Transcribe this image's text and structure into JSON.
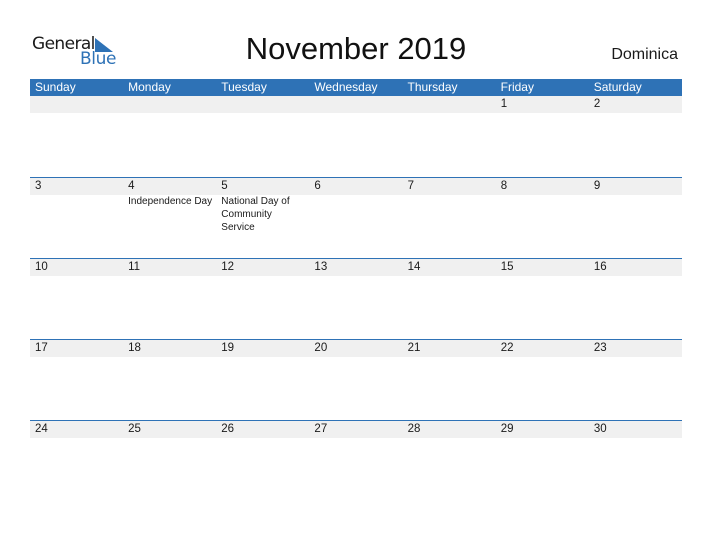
{
  "logo": {
    "general": "General",
    "blue": "Blue",
    "icon": "triangle-flag-icon",
    "brand_color": "#2e72b6"
  },
  "title": "November 2019",
  "country": "Dominica",
  "colors": {
    "header_bg": "#2e72b6",
    "date_strip_bg": "#f0f0f0",
    "week_divider": "#2e72b6"
  },
  "weekdays": [
    "Sunday",
    "Monday",
    "Tuesday",
    "Wednesday",
    "Thursday",
    "Friday",
    "Saturday"
  ],
  "weeks": [
    [
      {
        "day": ""
      },
      {
        "day": ""
      },
      {
        "day": ""
      },
      {
        "day": ""
      },
      {
        "day": ""
      },
      {
        "day": "1"
      },
      {
        "day": "2"
      }
    ],
    [
      {
        "day": "3"
      },
      {
        "day": "4",
        "holiday": "Independence Day"
      },
      {
        "day": "5",
        "holiday": "National Day of Community Service"
      },
      {
        "day": "6"
      },
      {
        "day": "7"
      },
      {
        "day": "8"
      },
      {
        "day": "9"
      }
    ],
    [
      {
        "day": "10"
      },
      {
        "day": "11"
      },
      {
        "day": "12"
      },
      {
        "day": "13"
      },
      {
        "day": "14"
      },
      {
        "day": "15"
      },
      {
        "day": "16"
      }
    ],
    [
      {
        "day": "17"
      },
      {
        "day": "18"
      },
      {
        "day": "19"
      },
      {
        "day": "20"
      },
      {
        "day": "21"
      },
      {
        "day": "22"
      },
      {
        "day": "23"
      }
    ],
    [
      {
        "day": "24"
      },
      {
        "day": "25"
      },
      {
        "day": "26"
      },
      {
        "day": "27"
      },
      {
        "day": "28"
      },
      {
        "day": "29"
      },
      {
        "day": "30"
      }
    ]
  ]
}
